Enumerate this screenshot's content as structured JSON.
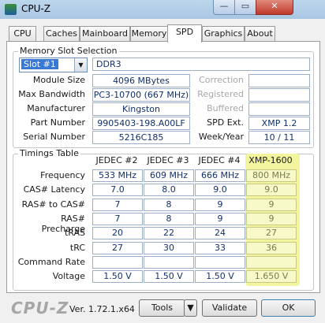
{
  "window": {
    "title": "CPU-Z",
    "minimize_glyph": "—",
    "maximize_glyph": "▭",
    "close_glyph": "✕"
  },
  "tabs": [
    "CPU",
    "Caches",
    "Mainboard",
    "Memory",
    "SPD",
    "Graphics",
    "About"
  ],
  "active_tab": "SPD",
  "memory_slot": {
    "group_title": "Memory Slot Selection",
    "slot_selected": "Slot #1",
    "type": "DDR3",
    "rows": [
      {
        "label": "Module Size",
        "value": "4096 MBytes",
        "rlabel": "Correction",
        "rvalue": ""
      },
      {
        "label": "Max Bandwidth",
        "value": "PC3-10700 (667 MHz)",
        "rlabel": "Registered",
        "rvalue": ""
      },
      {
        "label": "Manufacturer",
        "value": "Kingston",
        "rlabel": "Buffered",
        "rvalue": ""
      },
      {
        "label": "Part Number",
        "value": "9905403-198.A00LF",
        "rlabel": "SPD Ext.",
        "rvalue": "XMP 1.2"
      },
      {
        "label": "Serial Number",
        "value": "5216C185",
        "rlabel": "Week/Year",
        "rvalue": "10 / 11"
      }
    ]
  },
  "timings": {
    "group_title": "Timings Table",
    "columns": [
      "JEDEC #2",
      "JEDEC #3",
      "JEDEC #4",
      "XMP-1600"
    ],
    "rows": [
      {
        "label": "Frequency",
        "values": [
          "533 MHz",
          "609 MHz",
          "666 MHz",
          "800 MHz"
        ]
      },
      {
        "label": "CAS# Latency",
        "values": [
          "7.0",
          "8.0",
          "9.0",
          "9.0"
        ]
      },
      {
        "label": "RAS# to CAS#",
        "values": [
          "7",
          "8",
          "9",
          "9"
        ]
      },
      {
        "label": "RAS# Precharge",
        "values": [
          "7",
          "8",
          "9",
          "9"
        ]
      },
      {
        "label": "tRAS",
        "values": [
          "20",
          "22",
          "24",
          "27"
        ]
      },
      {
        "label": "tRC",
        "values": [
          "27",
          "30",
          "33",
          "36"
        ]
      },
      {
        "label": "Command Rate",
        "values": [
          "",
          "",
          "",
          ""
        ]
      },
      {
        "label": "Voltage",
        "values": [
          "1.50 V",
          "1.50 V",
          "1.50 V",
          "1.650 V"
        ]
      }
    ]
  },
  "footer": {
    "logo": "CPU-Z",
    "version": "Ver. 1.72.1.x64",
    "tools_label": "Tools",
    "validate_label": "Validate",
    "ok_label": "OK"
  },
  "colors": {
    "accent_highlight": "#f2f59e",
    "value_text": "#12306a"
  }
}
